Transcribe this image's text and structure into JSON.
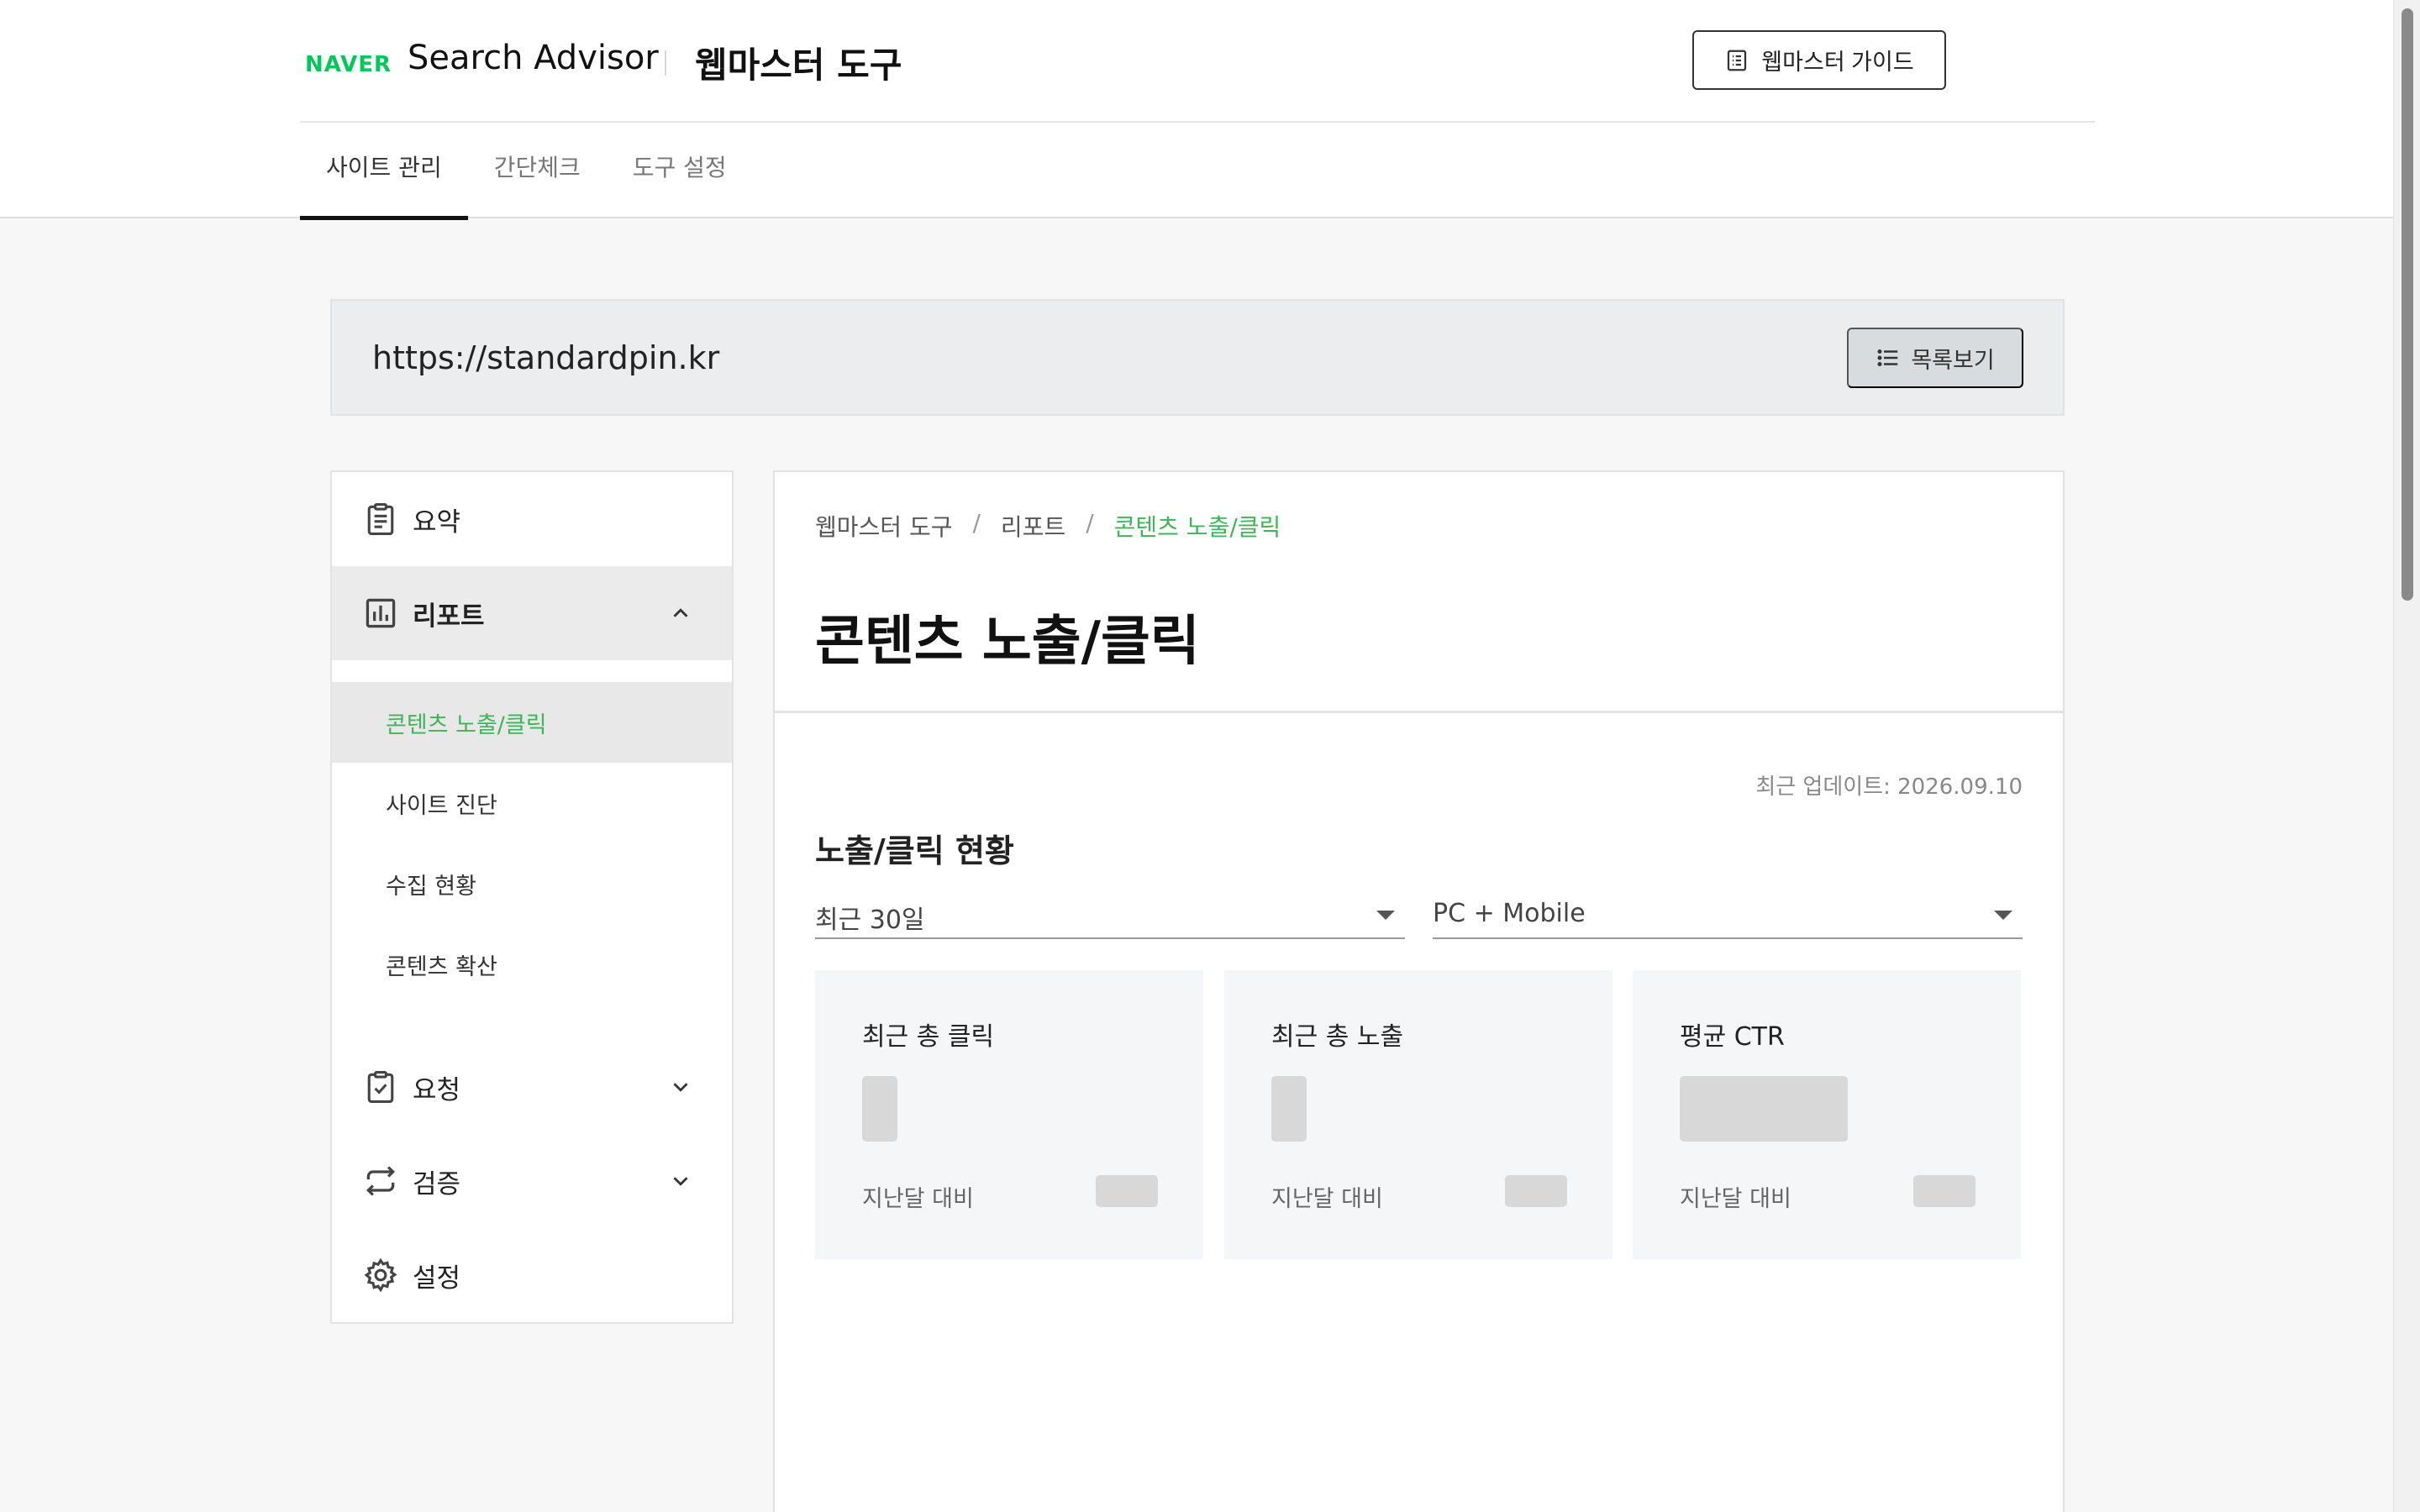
{
  "header": {
    "logo": "NAVER",
    "title": "Search Advisor",
    "subtitle": "웹마스터 도구",
    "guide_button": "웹마스터 가이드"
  },
  "main_tabs": [
    {
      "label": "사이트 관리",
      "active": true
    },
    {
      "label": "간단체크",
      "active": false
    },
    {
      "label": "도구 설정",
      "active": false
    }
  ],
  "site": {
    "url": "https://standardpin.kr",
    "list_button": "목록보기"
  },
  "sidebar": {
    "summary": "요약",
    "report": "리포트",
    "report_items": [
      "콘텐츠 노출/클릭",
      "사이트 진단",
      "수집 현황",
      "콘텐츠 확산"
    ],
    "request": "요청",
    "verify": "검증",
    "settings": "설정"
  },
  "breadcrumb": {
    "items": [
      "웹마스터 도구",
      "리포트",
      "콘텐츠 노출/클릭"
    ],
    "separator": "/"
  },
  "page": {
    "title": "콘텐츠 노출/클릭",
    "last_update": "최근 업데이트: 2026.09.10",
    "section_title": "노출/클릭 현황",
    "period_select": "최근 30일",
    "device_select": "PC + Mobile"
  },
  "stats": [
    {
      "label": "최근 총 클릭",
      "compare_label": "지난달 대비"
    },
    {
      "label": "최근 총 노출",
      "compare_label": "지난달 대비"
    },
    {
      "label": "평균 CTR",
      "compare_label": "지난달 대비"
    }
  ],
  "colors": {
    "brand_green": "#03c75a",
    "active_link_green": "#3fb45a",
    "placeholder_gray": "#d8d8d8"
  }
}
